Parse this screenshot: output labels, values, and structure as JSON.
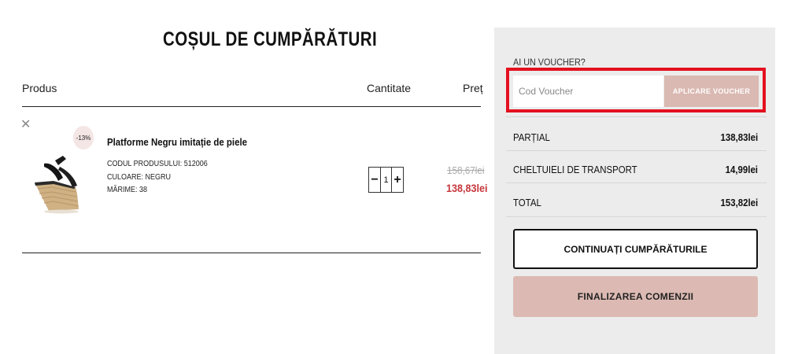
{
  "cart": {
    "title": "COȘUL DE CUMPĂRĂTURI",
    "columns": {
      "product": "Produs",
      "quantity": "Cantitate",
      "price": "Preț"
    },
    "items": [
      {
        "remove_icon": "close-icon",
        "badge": "-13%",
        "name": "Platforme Negru imitație de piele",
        "code_label": "CODUL PRODUSULUI:",
        "code_value": "512006",
        "color_label": "CULOARE:",
        "color_value": "NEGRU",
        "size_label": "MĂRIME:",
        "size_value": "38",
        "quantity": "1",
        "decrement": "−",
        "increment": "+",
        "price_old": "158,67lei",
        "price_new": "138,83lei"
      }
    ]
  },
  "summary": {
    "voucher_title": "AI UN VOUCHER?",
    "voucher_placeholder": "Cod Voucher",
    "voucher_button": "APLICARE VOUCHER",
    "partial_label": "PARȚIAL",
    "partial_value": "138,83lei",
    "shipping_label": "CHELTUIELI DE TRANSPORT",
    "shipping_value": "14,99lei",
    "total_label": "TOTAL",
    "total_value": "153,82lei",
    "continue_button": "CONTINUAȚI CUMPĂRĂTURILE",
    "finalize_button": "FINALIZAREA COMENZII"
  },
  "colors": {
    "accent": "#dab9b2",
    "sale_price": "#c6373c",
    "highlight": "#e3101f",
    "panel_bg": "#ececec"
  }
}
